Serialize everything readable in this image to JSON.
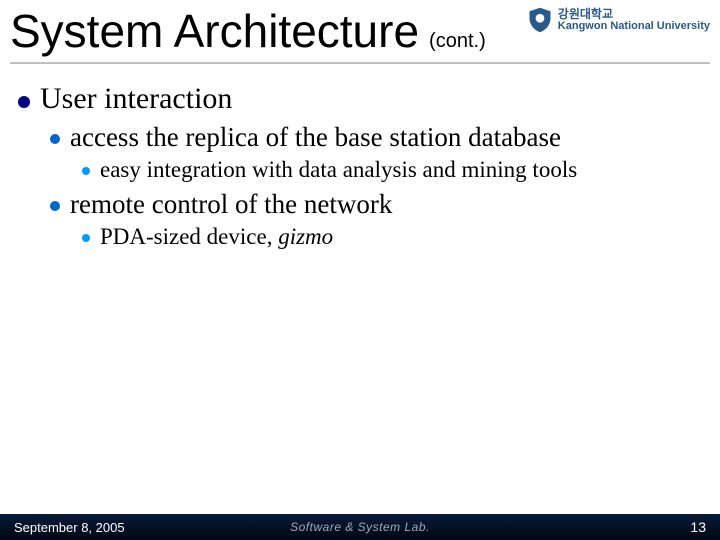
{
  "title": "System Architecture",
  "title_suffix": "(cont.)",
  "top_logo": {
    "kr": "강원대학교",
    "en": "Kangwon National University"
  },
  "bullets": {
    "l1": "User interaction",
    "l2a": "access the replica of the base station database",
    "l3a": "easy integration with data analysis and mining tools",
    "l2b": "remote control of the network",
    "l3b_pre": "PDA-sized device, ",
    "l3b_em": "gizmo"
  },
  "footer": {
    "date": "September 8, 2005",
    "center": "Software & System Lab.",
    "page": "13"
  }
}
